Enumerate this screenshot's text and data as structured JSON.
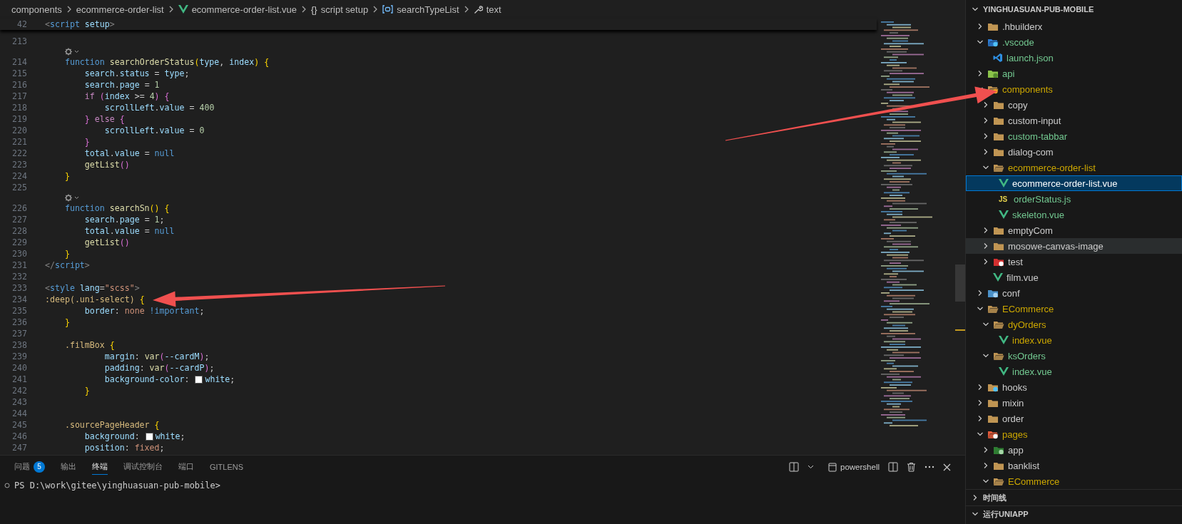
{
  "breadcrumb": [
    {
      "kind": "folder",
      "text": "components"
    },
    {
      "kind": "folder",
      "text": "ecommerce-order-list"
    },
    {
      "kind": "vue",
      "text": "ecommerce-order-list.vue"
    },
    {
      "kind": "braces",
      "icon": "{}",
      "text": "script setup"
    },
    {
      "kind": "symbol",
      "text": "searchTypeList"
    },
    {
      "kind": "wrench",
      "text": "text"
    }
  ],
  "sticky_line": {
    "n": "42",
    "text": "<script setup>"
  },
  "code": [
    {
      "kind": "code",
      "n": "213"
    },
    {
      "kind": "codelens"
    },
    {
      "kind": "code",
      "n": "214",
      "text": "    function searchOrderStatus(type, index) {"
    },
    {
      "kind": "code",
      "n": "215",
      "text": "        search.status = type;"
    },
    {
      "kind": "code",
      "n": "216",
      "text": "        search.page = 1"
    },
    {
      "kind": "code",
      "n": "217",
      "text": "        if (index >= 4) {"
    },
    {
      "kind": "code",
      "n": "218",
      "text": "            scrollLeft.value = 400"
    },
    {
      "kind": "code",
      "n": "219",
      "text": "        } else {"
    },
    {
      "kind": "code",
      "n": "220",
      "text": "            scrollLeft.value = 0"
    },
    {
      "kind": "code",
      "n": "221",
      "text": "        }"
    },
    {
      "kind": "code",
      "n": "222",
      "text": "        total.value = null"
    },
    {
      "kind": "code",
      "n": "223",
      "text": "        getList()"
    },
    {
      "kind": "code",
      "n": "224",
      "text": "    }"
    },
    {
      "kind": "code",
      "n": "225"
    },
    {
      "kind": "codelens"
    },
    {
      "kind": "code",
      "n": "226",
      "text": "    function searchSn() {"
    },
    {
      "kind": "code",
      "n": "227",
      "text": "        search.page = 1;"
    },
    {
      "kind": "code",
      "n": "228",
      "text": "        total.value = null"
    },
    {
      "kind": "code",
      "n": "229",
      "text": "        getList()"
    },
    {
      "kind": "code",
      "n": "230",
      "text": "    }"
    },
    {
      "kind": "code",
      "n": "231",
      "text": "</script>"
    },
    {
      "kind": "code",
      "n": "232"
    },
    {
      "kind": "code",
      "n": "233",
      "text": "<style lang=\"scss\">"
    },
    {
      "kind": "code",
      "n": "234",
      "text": ":deep(.uni-select) {"
    },
    {
      "kind": "code",
      "n": "235",
      "text": "        border: none !important;"
    },
    {
      "kind": "code",
      "n": "236",
      "text": "    }"
    },
    {
      "kind": "code",
      "n": "237"
    },
    {
      "kind": "code",
      "n": "238",
      "text": "    .filmBox {"
    },
    {
      "kind": "code",
      "n": "239",
      "text": "            margin: var(--cardM);"
    },
    {
      "kind": "code",
      "n": "240",
      "text": "            padding: var(--cardP);"
    },
    {
      "kind": "code",
      "n": "241",
      "text": "            background-color: ",
      "swatch": {
        "color": "#ffffff"
      },
      "text_after_swatch": "white;"
    },
    {
      "kind": "code",
      "n": "242",
      "text": "        }"
    },
    {
      "kind": "code",
      "n": "243"
    },
    {
      "kind": "code",
      "n": "244"
    },
    {
      "kind": "code",
      "n": "245",
      "text": "    .sourcePageHeader {"
    },
    {
      "kind": "code",
      "n": "246",
      "text": "        background: ",
      "swatch": {
        "color": "#ffffff"
      },
      "text_after_swatch": "white;"
    },
    {
      "kind": "code",
      "n": "247",
      "text": "        position: fixed;"
    }
  ],
  "panel": {
    "tabs": [
      {
        "label": "问题",
        "badge": "5",
        "selected": false
      },
      {
        "label": "输出",
        "selected": false
      },
      {
        "label": "终端",
        "selected": true
      },
      {
        "label": "调试控制台",
        "selected": false
      },
      {
        "label": "端口",
        "selected": false
      },
      {
        "label": "GITLENS",
        "selected": false
      }
    ],
    "terminal_name": "powershell",
    "terminal_lines": [
      "PS D:\\work\\gitee\\yinghuasuan-pub-mobile>"
    ]
  },
  "explorer": {
    "title": "YINGHUASUAN-PUB-MOBILE",
    "expanded": true,
    "items": [
      {
        "name": ".hbuilderx",
        "kind": "folder",
        "color": "#cccccc",
        "expanded": false,
        "selected": false,
        "hovered": false
      },
      {
        "name": ".vscode",
        "kind": "settingsfolder",
        "color": "#73c991",
        "expanded": true,
        "selected": false,
        "hovered": false,
        "children": [
          {
            "name": "launch.json",
            "kind": "editorfile",
            "color": "#73c991",
            "selected": false,
            "hovered": false
          }
        ]
      },
      {
        "name": "api",
        "kind": "apifolder",
        "color": "#73c991",
        "expanded": false,
        "selected": false,
        "hovered": false
      },
      {
        "name": "components",
        "kind": "componentsfolder",
        "color": "#cca700",
        "expanded": true,
        "selected": false,
        "hovered": false,
        "children": [
          {
            "name": "copy",
            "kind": "folder",
            "color": "#cccccc",
            "expanded": false,
            "selected": false,
            "hovered": false
          },
          {
            "name": "custom-input",
            "kind": "folder",
            "color": "#cccccc",
            "expanded": false,
            "selected": false,
            "hovered": false
          },
          {
            "name": "custom-tabbar",
            "kind": "folder",
            "color": "#73c991",
            "expanded": false,
            "selected": false,
            "hovered": false
          },
          {
            "name": "dialog-com",
            "kind": "folder",
            "color": "#cccccc",
            "expanded": false,
            "selected": false,
            "hovered": false
          },
          {
            "name": "ecommerce-order-list",
            "kind": "folder",
            "color": "#cca700",
            "expanded": true,
            "selected": false,
            "hovered": false,
            "children": [
              {
                "name": "ecommerce-order-list.vue",
                "kind": "vue",
                "color": "#ffffff",
                "selected": true,
                "hovered": false
              },
              {
                "name": "orderStatus.js",
                "kind": "js",
                "icon_text": "JS",
                "color": "#73c991",
                "selected": false,
                "hovered": false
              },
              {
                "name": "skeleton.vue",
                "kind": "vue",
                "color": "#73c991",
                "selected": false,
                "hovered": false
              }
            ]
          },
          {
            "name": "emptyCom",
            "kind": "folder",
            "color": "#cccccc",
            "expanded": false,
            "selected": false,
            "hovered": false
          },
          {
            "name": "mosowe-canvas-image",
            "kind": "folder",
            "color": "#cccccc",
            "expanded": false,
            "selected": false,
            "hovered": true
          },
          {
            "name": "test",
            "kind": "testfolder",
            "color": "#cccccc",
            "expanded": false,
            "selected": false,
            "hovered": false
          },
          {
            "name": "film.vue",
            "kind": "vue",
            "color": "#cccccc",
            "selected": false,
            "hovered": false
          }
        ]
      },
      {
        "name": "conf",
        "kind": "conffolder",
        "color": "#cccccc",
        "expanded": false,
        "selected": false,
        "hovered": false
      },
      {
        "name": "ECommerce",
        "kind": "folder",
        "color": "#cca700",
        "expanded": true,
        "selected": false,
        "hovered": false,
        "children": [
          {
            "name": "dyOrders",
            "kind": "folder",
            "color": "#cca700",
            "expanded": true,
            "selected": false,
            "hovered": false,
            "children": [
              {
                "name": "index.vue",
                "kind": "vue",
                "color": "#cca700",
                "selected": false,
                "hovered": false
              }
            ]
          },
          {
            "name": "ksOrders",
            "kind": "folder",
            "color": "#73c991",
            "expanded": true,
            "selected": false,
            "hovered": false,
            "children": [
              {
                "name": "index.vue",
                "kind": "vue",
                "color": "#73c991",
                "selected": false,
                "hovered": false
              }
            ]
          }
        ]
      },
      {
        "name": "hooks",
        "kind": "hooksfolder",
        "color": "#cccccc",
        "expanded": false,
        "selected": false,
        "hovered": false
      },
      {
        "name": "mixin",
        "kind": "folder",
        "color": "#cccccc",
        "expanded": false,
        "selected": false,
        "hovered": false
      },
      {
        "name": "order",
        "kind": "folder",
        "color": "#cccccc",
        "expanded": false,
        "selected": false,
        "hovered": false
      },
      {
        "name": "pages",
        "kind": "pagesfolder",
        "color": "#cca700",
        "expanded": true,
        "selected": false,
        "hovered": false,
        "children": [
          {
            "name": "app",
            "kind": "appfolder",
            "color": "#cccccc",
            "expanded": false,
            "selected": false,
            "hovered": false
          },
          {
            "name": "banklist",
            "kind": "folder",
            "color": "#cccccc",
            "expanded": false,
            "selected": false,
            "hovered": false
          },
          {
            "name": "ECommerce",
            "kind": "folder",
            "color": "#cca700",
            "expanded": true,
            "selected": false,
            "hovered": false
          }
        ]
      }
    ],
    "sections": [
      {
        "title": "时间线",
        "expanded": false
      },
      {
        "title": "运行UNIAPP",
        "expanded": true
      }
    ]
  },
  "annotations": [
    {
      "kind": "arrow"
    },
    {
      "kind": "arrow"
    }
  ]
}
